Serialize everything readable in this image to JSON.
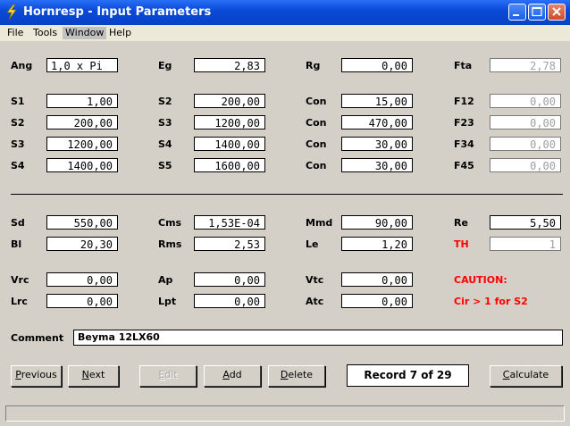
{
  "window": {
    "title": "Hornresp - Input Parameters"
  },
  "menu": [
    {
      "label": "File"
    },
    {
      "label": "Tools"
    },
    {
      "label": "Window"
    },
    {
      "label": "Help"
    }
  ],
  "params": {
    "ang": {
      "label": "Ang",
      "value": "1,0 x Pi"
    },
    "eg": {
      "label": "Eg",
      "value": "2,83"
    },
    "rg": {
      "label": "Rg",
      "value": "0,00"
    },
    "fta": {
      "label": "Fta",
      "value": "2,78"
    },
    "s1a": {
      "label": "S1",
      "value": "1,00"
    },
    "s2a": {
      "label": "S2",
      "value": "200,00"
    },
    "con1": {
      "label": "Con",
      "value": "15,00"
    },
    "f12": {
      "label": "F12",
      "value": "0,00"
    },
    "s2b": {
      "label": "S2",
      "value": "200,00"
    },
    "s3a": {
      "label": "S3",
      "value": "1200,00"
    },
    "con2": {
      "label": "Con",
      "value": "470,00"
    },
    "f23": {
      "label": "F23",
      "value": "0,00"
    },
    "s3b": {
      "label": "S3",
      "value": "1200,00"
    },
    "s4a": {
      "label": "S4",
      "value": "1400,00"
    },
    "con3": {
      "label": "Con",
      "value": "30,00"
    },
    "f34": {
      "label": "F34",
      "value": "0,00"
    },
    "s4b": {
      "label": "S4",
      "value": "1400,00"
    },
    "s5a": {
      "label": "S5",
      "value": "1600,00"
    },
    "con4": {
      "label": "Con",
      "value": "30,00"
    },
    "f45": {
      "label": "F45",
      "value": "0,00"
    },
    "sd": {
      "label": "Sd",
      "value": "550,00"
    },
    "cms": {
      "label": "Cms",
      "value": "1,53E-04"
    },
    "mmd": {
      "label": "Mmd",
      "value": "90,00"
    },
    "re": {
      "label": "Re",
      "value": "5,50"
    },
    "bl": {
      "label": "Bl",
      "value": "20,30"
    },
    "rms": {
      "label": "Rms",
      "value": "2,53"
    },
    "le": {
      "label": "Le",
      "value": "1,20"
    },
    "th": {
      "label": "TH",
      "value": "1"
    },
    "vrc": {
      "label": "Vrc",
      "value": "0,00"
    },
    "ap": {
      "label": "Ap",
      "value": "0,00"
    },
    "vtc": {
      "label": "Vtc",
      "value": "0,00"
    },
    "lrc": {
      "label": "Lrc",
      "value": "0,00"
    },
    "lpt": {
      "label": "Lpt",
      "value": "0,00"
    },
    "atc": {
      "label": "Atc",
      "value": "0,00"
    }
  },
  "caution": {
    "title": "CAUTION:",
    "message": "Cir > 1 for S2",
    "color": "#ff0000"
  },
  "comment": {
    "label": "Comment",
    "value": "Beyma 12LX60"
  },
  "buttons": {
    "previous": "Previous",
    "next": "Next",
    "edit": "Edit",
    "add": "Add",
    "delete": "Delete",
    "calculate": "Calculate"
  },
  "record": {
    "text": "Record 7 of 29"
  }
}
